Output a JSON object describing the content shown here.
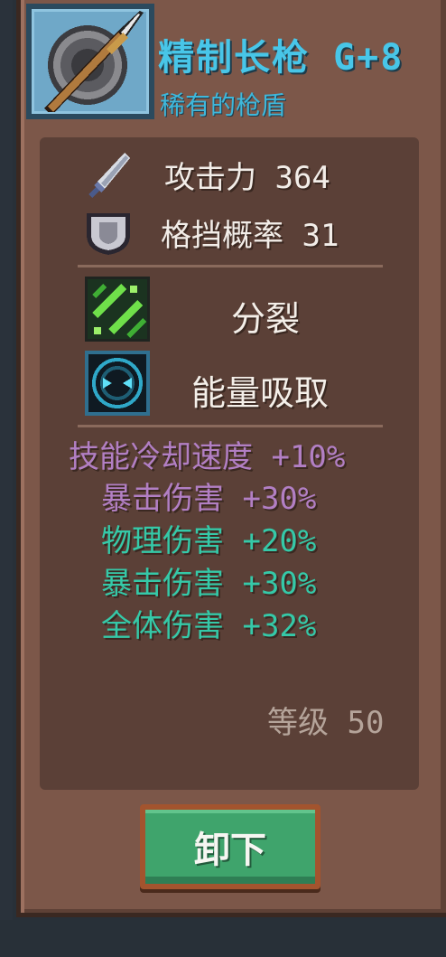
{
  "item": {
    "name": "精制长枪 G+8",
    "subtitle": "稀有的枪盾",
    "icon": "spear-shield-icon"
  },
  "stats": [
    {
      "icon": "sword-icon",
      "text": "攻击力 364"
    },
    {
      "icon": "shield-icon",
      "text": "格挡概率 31"
    }
  ],
  "abilities": [
    {
      "icon": "split-arrows-icon",
      "label": "分裂"
    },
    {
      "icon": "energy-absorb-icon",
      "label": "能量吸取"
    }
  ],
  "bonuses": [
    {
      "text": "技能冷却速度 +10%",
      "color": "#b27fc4"
    },
    {
      "text": "暴击伤害 +30%",
      "color": "#b27fc4"
    },
    {
      "text": "物理伤害 +20%",
      "color": "#35c9a8"
    },
    {
      "text": "暴击伤害 +30%",
      "color": "#35c9a8"
    },
    {
      "text": "全体伤害 +32%",
      "color": "#35c9a8"
    }
  ],
  "level_text": "等级 50",
  "unequip_label": "卸下",
  "colors": {
    "title": "#48c6e8",
    "panel": "#7c5749",
    "inner": "#5b4037",
    "button": "#3fa46c"
  }
}
